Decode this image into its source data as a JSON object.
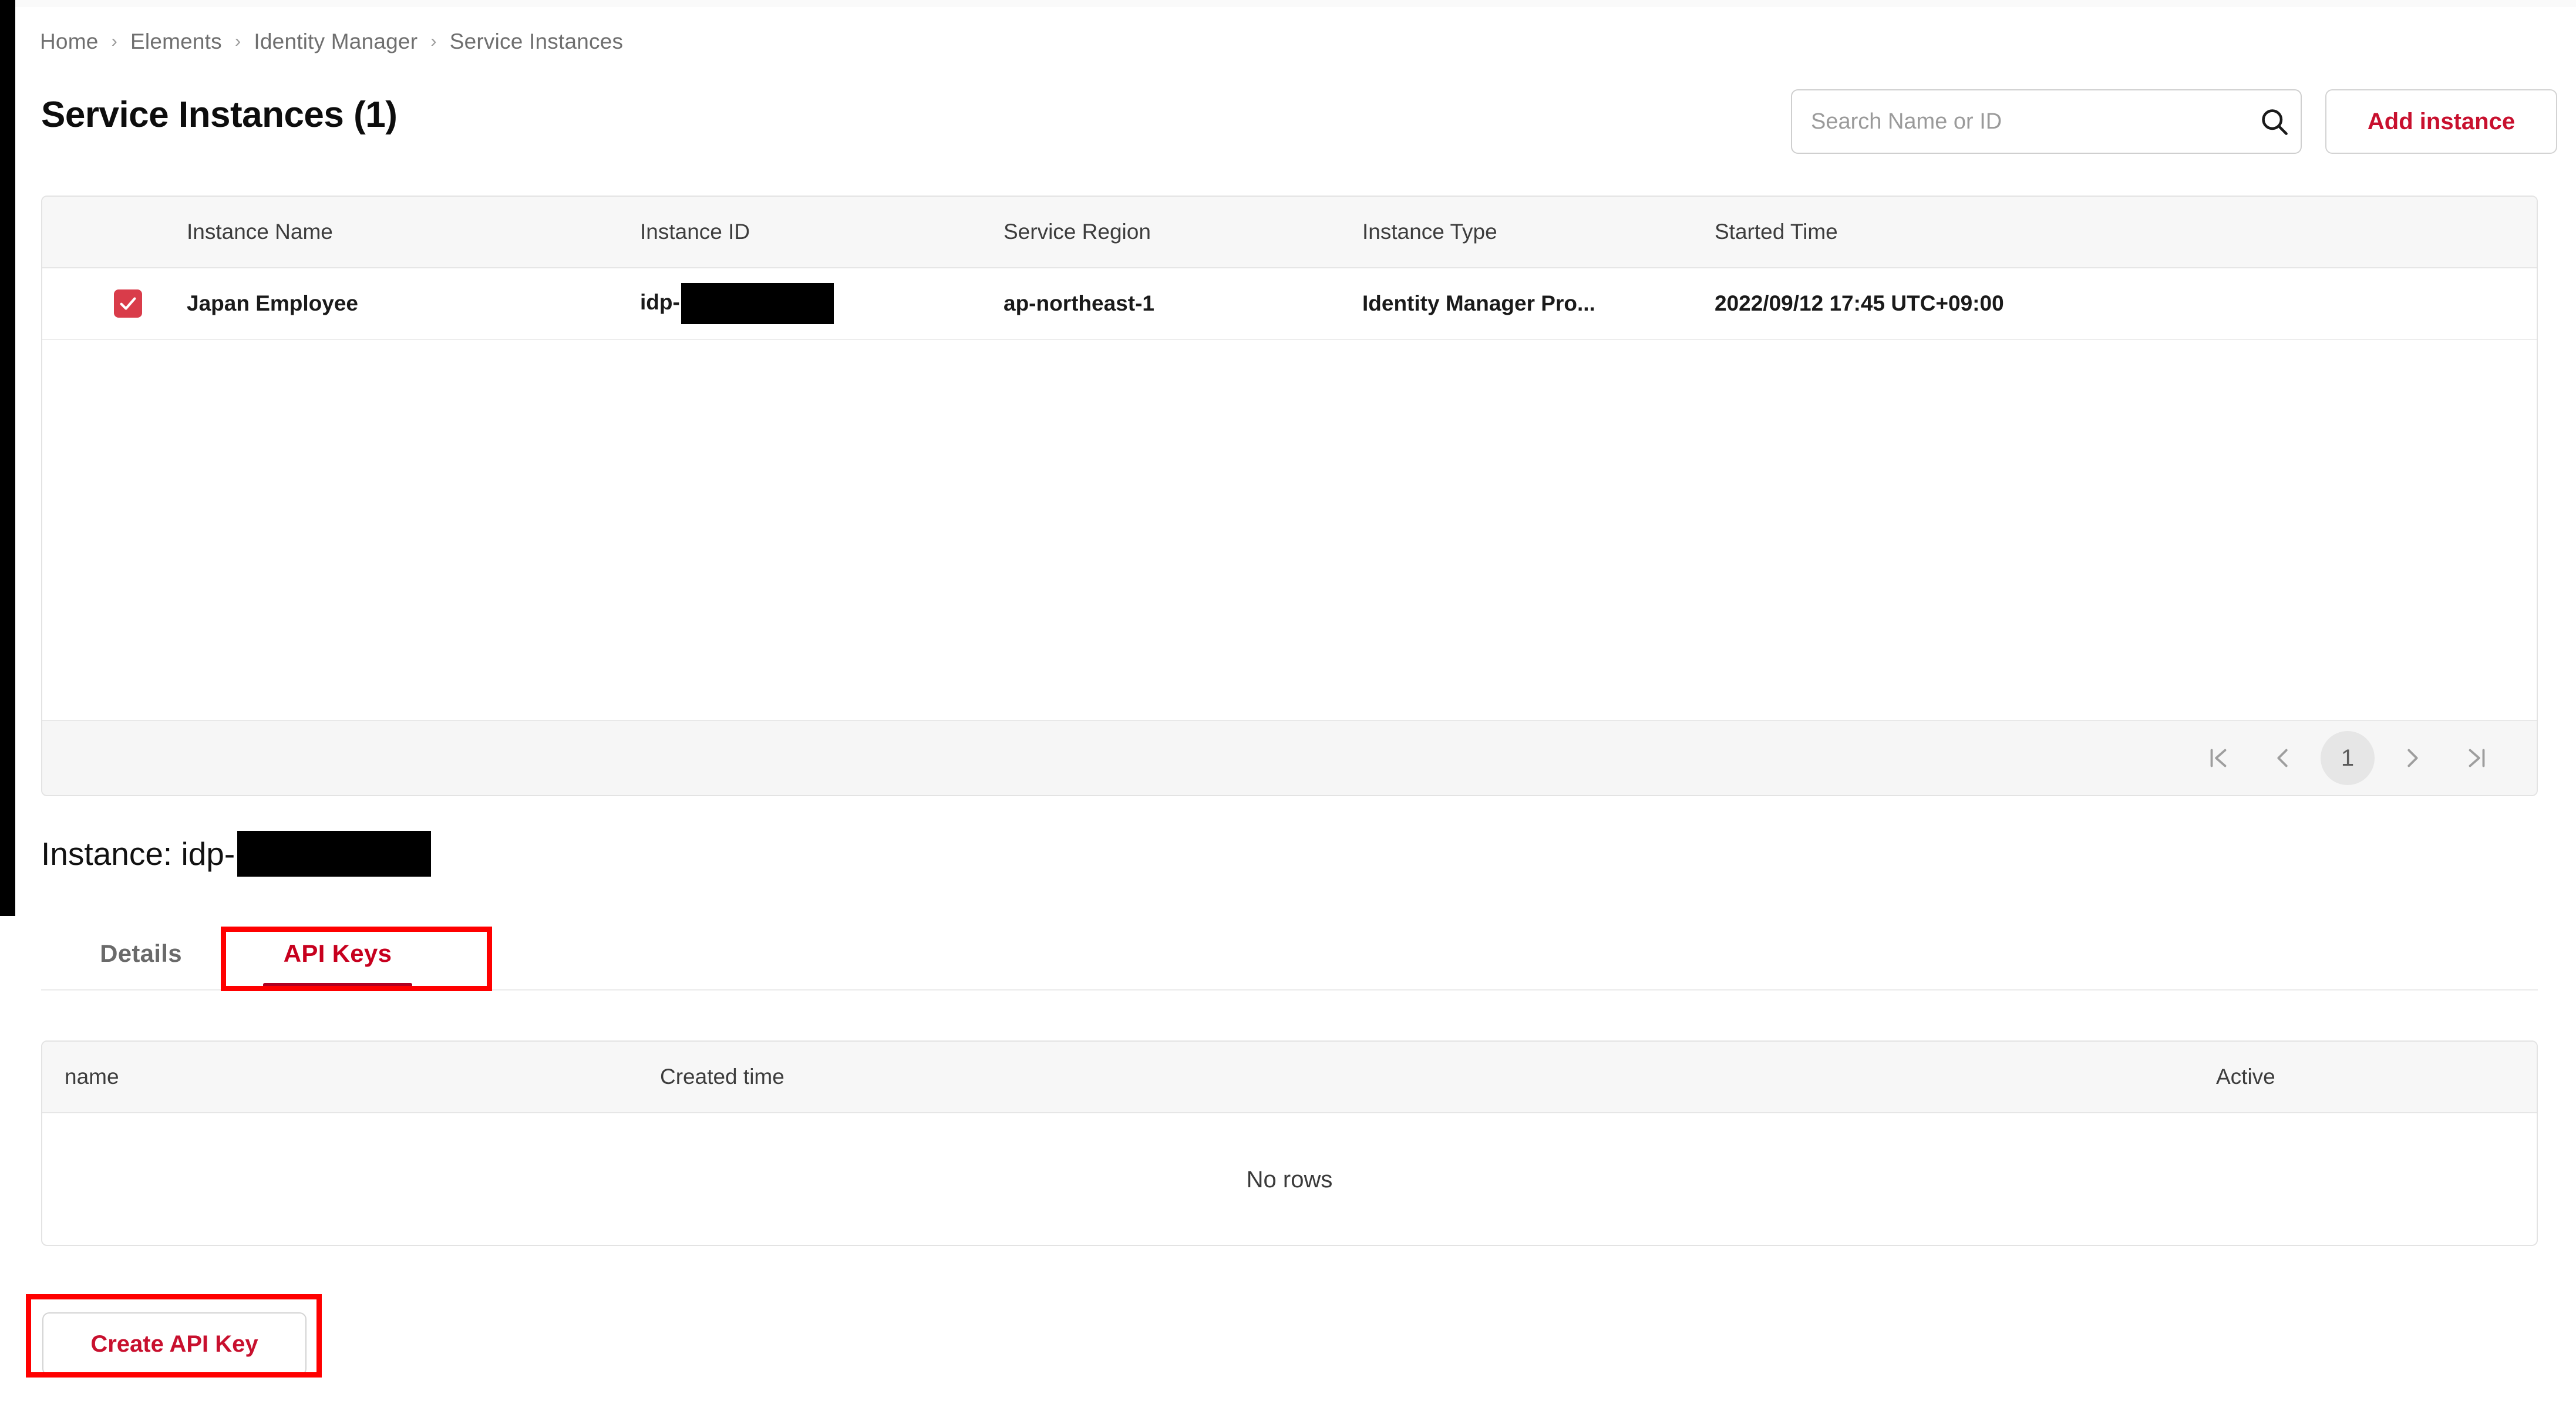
{
  "breadcrumb": {
    "separator": "›",
    "items": [
      {
        "label": "Home"
      },
      {
        "label": "Elements"
      },
      {
        "label": "Identity Manager"
      },
      {
        "label": "Service Instances"
      }
    ]
  },
  "header": {
    "title": "Service Instances (1)",
    "search": {
      "placeholder": "Search Name or ID",
      "value": "",
      "icon": "search-icon"
    },
    "add_instance_label": "Add instance"
  },
  "instances_grid": {
    "columns": [
      "Instance Name",
      "Instance ID",
      "Service Region",
      "Instance Type",
      "Started Time"
    ],
    "rows": [
      {
        "selected": true,
        "instance_name": "Japan Employee",
        "instance_id_prefix": "idp-",
        "instance_id_redacted": true,
        "service_region": "ap-northeast-1",
        "instance_type": "Identity Manager Pro...",
        "started_time": "2022/09/12 17:45 UTC+09:00"
      }
    ],
    "pagination": {
      "first_icon": "first-page-icon",
      "prev_icon": "previous-page-icon",
      "current_page": "1",
      "next_icon": "next-page-icon",
      "last_icon": "last-page-icon"
    }
  },
  "instance_detail": {
    "title_prefix": "Instance: idp-",
    "title_redacted": true,
    "tabs": [
      {
        "label": "Details",
        "active": false
      },
      {
        "label": "API Keys",
        "active": true
      }
    ]
  },
  "api_keys_grid": {
    "columns": [
      "name",
      "Created time",
      "Active"
    ],
    "empty_message": "No rows",
    "create_button_label": "Create API Key"
  },
  "colors": {
    "accent_red": "#c8102e",
    "tab_active_red": "#c7001e",
    "tab_underline_red": "#b00020",
    "checkbox_red": "#d93c4a",
    "annotation_red": "#ff0000",
    "header_bg": "#f7f7f7",
    "border": "#e3e3e3",
    "text_primary": "#1a1a1a",
    "text_muted": "#6b6b6b",
    "redaction_black": "#000000"
  }
}
